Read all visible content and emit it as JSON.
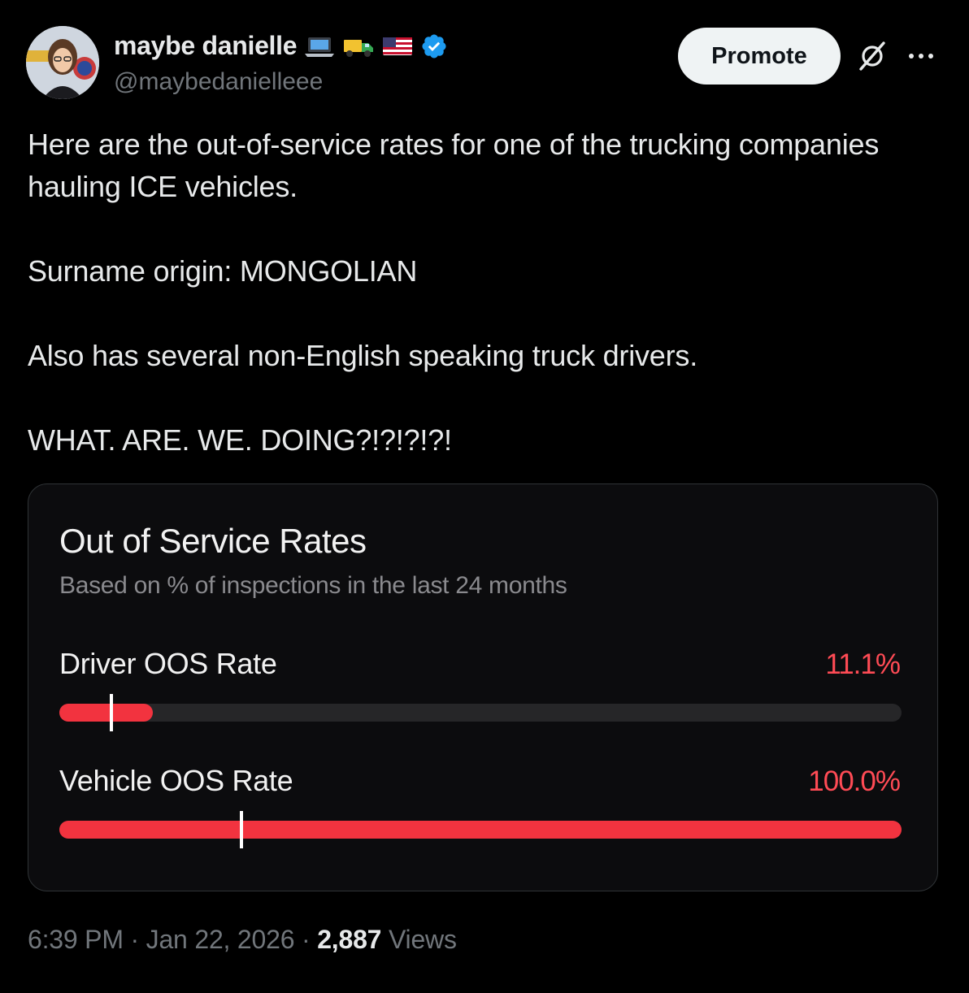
{
  "tweet": {
    "author": {
      "display_name": "maybe danielle",
      "name_emojis": [
        "laptop-emoji",
        "delivery-truck-emoji",
        "us-flag-emoji"
      ],
      "verified": true,
      "handle": "@maybedanielleee"
    },
    "promote_label": "Promote",
    "text_lines": [
      "Here are the out-of-service rates for one of the trucking companies hauling ICE vehicles.",
      "Surname origin: MONGOLIAN",
      "Also has several non-English speaking truck drivers.",
      "WHAT. ARE. WE. DOING?!?!?!?!"
    ],
    "meta": {
      "time": "6:39 PM",
      "separator": "·",
      "date": "Jan 22, 2026",
      "views_count": "2,887",
      "views_label": "Views"
    }
  },
  "card": {
    "title": "Out of Service Rates",
    "subtitle": "Based on % of inspections in the last 24 months",
    "rows": [
      {
        "label": "Driver OOS Rate",
        "value": "11.1%",
        "fill_fraction": 0.111,
        "marker_fraction": 0.062
      },
      {
        "label": "Vehicle OOS Rate",
        "value": "100.0%",
        "fill_fraction": 1.0,
        "marker_fraction": 0.216
      }
    ]
  },
  "colors": {
    "background": "#000000",
    "text": "#e7e9ea",
    "muted": "#71767b",
    "verified_blue": "#1d9bf0",
    "oos_red": "#f2333f",
    "value_red": "#ff4b55"
  }
}
